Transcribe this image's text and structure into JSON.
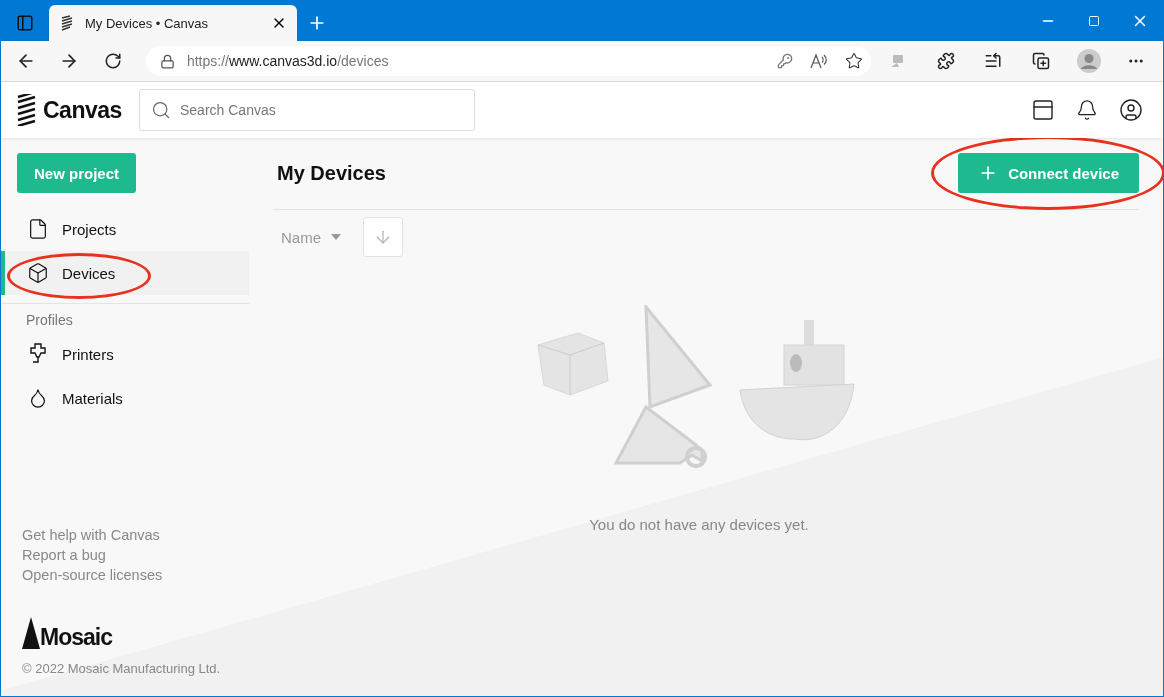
{
  "browser": {
    "tab_title": "My Devices • Canvas",
    "url_host": "https://www.canvas3d.io",
    "url_path": "/devices"
  },
  "header": {
    "brand": "Canvas",
    "search": {
      "placeholder": "Search Canvas"
    }
  },
  "sidebar": {
    "primary_button": "New project",
    "items": [
      {
        "label": "Projects",
        "selected": false
      },
      {
        "label": "Devices",
        "selected": true
      }
    ],
    "section_title": "Profiles",
    "profile_items": [
      {
        "label": "Printers",
        "selected": false
      },
      {
        "label": "Materials",
        "selected": false
      }
    ],
    "links": [
      "Get help with Canvas",
      "Report a bug",
      "Open-source licenses"
    ],
    "company": "Mosaic",
    "copyright": "© 2022 Mosaic Manufacturing Ltd."
  },
  "main": {
    "title": "My Devices",
    "action_button": "Connect device",
    "sort": {
      "label": "Name"
    },
    "empty_message": "You do not have any devices yet."
  }
}
